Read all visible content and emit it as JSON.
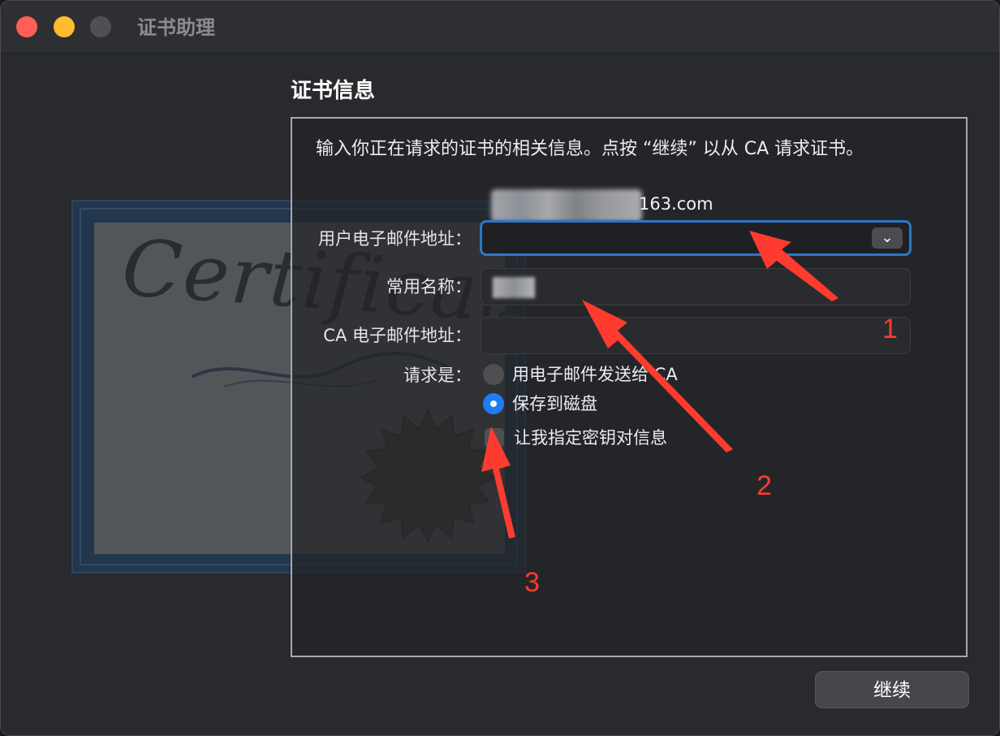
{
  "window": {
    "title": "证书助理"
  },
  "certificate_art": {
    "script_text": "Certificate"
  },
  "section": {
    "title": "证书信息",
    "instructions": "输入你正在请求的证书的相关信息。点按 “继续” 以从 CA 请求证书。"
  },
  "form": {
    "email_hint_suffix": "163.com",
    "user_email_label": "用户电子邮件地址：",
    "user_email_value": "",
    "common_name_label": "常用名称：",
    "common_name_value": "",
    "ca_email_label": "CA 电子邮件地址：",
    "ca_email_value": "",
    "request_label": "请求是：",
    "option_email_ca": "用电子邮件发送给 CA",
    "option_save_disk": "保存到磁盘",
    "selected_option": "option_save_disk",
    "let_me_specify": "让我指定密钥对信息"
  },
  "annotations": {
    "n1": "1",
    "n2": "2",
    "n3": "3",
    "color": "#ff3b30"
  },
  "footer": {
    "continue_label": "继续"
  },
  "colors": {
    "accent": "#1e7cf5",
    "focus_ring": "#2a77c9",
    "close": "#ff5f57",
    "minimize": "#febc2e"
  },
  "icons": {
    "select_chevron": "chevron-down-icon"
  }
}
